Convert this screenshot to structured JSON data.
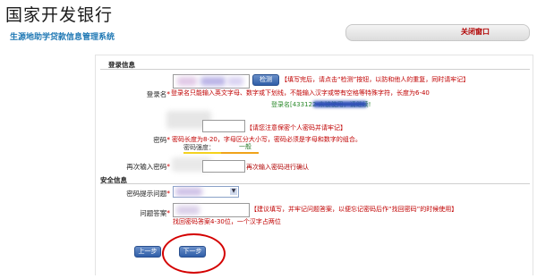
{
  "header": {
    "logo_text": "国家开发银行",
    "subtitle": "生源地助学贷款信息管理系统",
    "close_label": "关闭窗口"
  },
  "login_section": {
    "title": "登录信息",
    "username_label": "登录名",
    "check_button": "检测",
    "hint_line1": "【填写完后，请点击“检测”按钮，以防和他人的重复，同时请牢记】",
    "hint_line2": "登录名只能输入英文字母、数字或下划线，不能输入汉字或带有空格等特殊字符，长度为6-40",
    "available_message": "登录名[433122                未被使用，请继续!",
    "password_label": "密码",
    "password_hint1": "【请您注意保密个人密码并请牢记】",
    "password_hint2": "密码长度为8-20，字母区分大小写，密码必须是字母和数字的组合。",
    "strength_label": "密码强度：",
    "strength_value": "一般",
    "repeat_label": "再次输入密码",
    "repeat_hint": "再次输入密码进行确认"
  },
  "security_section": {
    "title": "安全信息",
    "question_label": "密码提示问题",
    "answer_label": "问题答案",
    "answer_hint1": "【建议填写，并牢记问题答案，以便忘记密码后作“找回密码”的时候使用】",
    "answer_hint2": "找回密码答案4-30位，一个汉字占两位"
  },
  "buttons": {
    "prev": "上一步",
    "next": "下一步"
  },
  "colors": {
    "accent_blue": "#2f5ea8",
    "hint_red": "#c00000",
    "ok_green": "#2c8a2c",
    "highlight_circle": "#d40000"
  }
}
